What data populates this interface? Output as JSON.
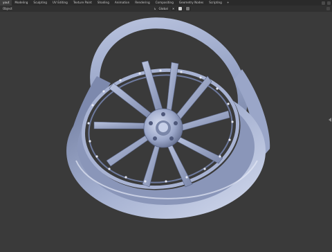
{
  "workspace_tabs": [
    {
      "label": "yout",
      "active": true
    },
    {
      "label": "Modeling",
      "active": false
    },
    {
      "label": "Sculpting",
      "active": false
    },
    {
      "label": "UV Editing",
      "active": false
    },
    {
      "label": "Texture Paint",
      "active": false
    },
    {
      "label": "Shading",
      "active": false
    },
    {
      "label": "Animation",
      "active": false
    },
    {
      "label": "Rendering",
      "active": false
    },
    {
      "label": "Compositing",
      "active": false
    },
    {
      "label": "Geometry Nodes",
      "active": false
    },
    {
      "label": "Scripting",
      "active": false
    }
  ],
  "workspace_more": "+",
  "header": {
    "mode": "Object",
    "transform_orientation": "Global",
    "pivot": "↳"
  },
  "colors": {
    "viewport_bg": "#3a3a3a",
    "wheel_base": "#8f9cbf",
    "wheel_light": "#c9d2ea",
    "wheel_dark": "#4c5676"
  }
}
